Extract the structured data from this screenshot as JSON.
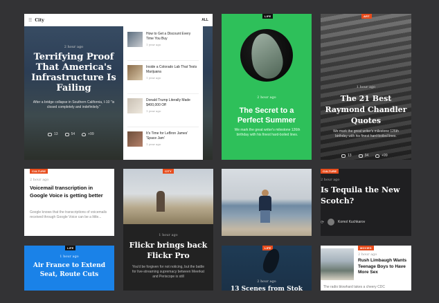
{
  "card1": {
    "logo": "City",
    "nav_label": "ALL",
    "time": "2 hour ago",
    "title": "Terrifying Proof That America's Infrastructure Is Failing",
    "excerpt": "After a bridge collapse in Southern California, I-10 \"is closed completely and indefinitely.\"",
    "stats": {
      "views": "13",
      "comments": "54",
      "likes": "+99"
    },
    "related": [
      {
        "title": "How to Get a Discount Every Time You Buy",
        "time": "1 year ago"
      },
      {
        "title": "Inside a Colorado Lab That Tests Marijuana",
        "time": "1 year ago"
      },
      {
        "title": "Donald Trump Literally Made $400,000 Off",
        "time": "1 year ago"
      },
      {
        "title": "It's Time for LeBron James' 'Space Jam'",
        "time": "1 year ago"
      }
    ]
  },
  "card2": {
    "tag": "LIFE",
    "time": "2 hour ago",
    "title": "The Secret to a Perfect Summer",
    "excerpt": "We mark the great writer's milestone 126th birthday with his finest hard-boiled lines."
  },
  "card3": {
    "tag": "ART",
    "time": "1 hour ago",
    "title": "The 21 Best Raymond Chandler Quotes",
    "excerpt": "We mark the great writer's milestone 126th birthday with his finest hard-boiled lines.",
    "stats": {
      "views": "13",
      "comments": "34",
      "likes": "+99"
    }
  },
  "card4": {
    "tag": "CULTURE",
    "time": "2 hour ago",
    "title": "Voicemail transcription in Google Voice is getting better",
    "excerpt": "Google knows that the transcriptions of voicemails received through Google Voice can be a little..."
  },
  "card5": {
    "tag": "CITY",
    "time": "1 hour ago",
    "title": "Flickr brings back Flickr Pro",
    "excerpt": "You'd be forgiven for not noticing, but the battle for live-streaming supremacy between Meerkat and Periscope is still"
  },
  "card7": {
    "tag": "CULTURE",
    "time": "2 hour ago",
    "title": "Is Tequila the New Scotch?",
    "author_name": "Komol Kuchkarov"
  },
  "card8": {
    "tag": "LIFE",
    "time": "1 hour ago",
    "title": "Air France to Extend Seat, Route Cuts"
  },
  "card9": {
    "tag": "LIFE",
    "time": "2 hour ago",
    "title": "13 Scenes from Stok"
  },
  "card10": {
    "tag": "MOVIES",
    "time": "2 hour ago",
    "title": "Rush Limbaugh Wants Teenage Boys to Have More Sex",
    "excerpt": "The radio blowhard takes a cheery CDC"
  }
}
